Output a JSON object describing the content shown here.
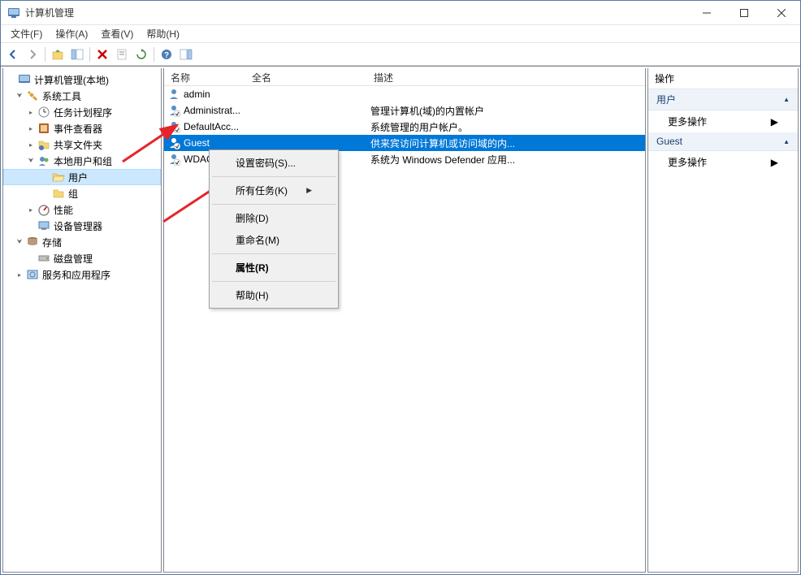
{
  "window": {
    "title": "计算机管理"
  },
  "menubar": {
    "file": "文件(F)",
    "action": "操作(A)",
    "view": "查看(V)",
    "help": "帮助(H)"
  },
  "tree": {
    "root": "计算机管理(本地)",
    "system_tools": "系统工具",
    "task_scheduler": "任务计划程序",
    "event_viewer": "事件查看器",
    "shared_folders": "共享文件夹",
    "local_users_groups": "本地用户和组",
    "users": "用户",
    "groups": "组",
    "performance": "性能",
    "device_manager": "设备管理器",
    "storage": "存储",
    "disk_management": "磁盘管理",
    "services_apps": "服务和应用程序"
  },
  "list": {
    "columns": {
      "name": "名称",
      "fullname": "全名",
      "description": "描述"
    },
    "rows": [
      {
        "name": "admin",
        "fullname": "",
        "description": "",
        "disabled": false
      },
      {
        "name": "Administrat...",
        "fullname": "",
        "description": "管理计算机(域)的内置帐户",
        "disabled": true
      },
      {
        "name": "DefaultAcc...",
        "fullname": "",
        "description": "系统管理的用户帐户。",
        "disabled": true
      },
      {
        "name": "Guest",
        "fullname": "",
        "description": "供来宾访问计算机或访问域的内...",
        "disabled": true,
        "selected": true
      },
      {
        "name": "WDAG...",
        "fullname": "",
        "description": "系统为 Windows Defender 应用...",
        "disabled": true
      }
    ]
  },
  "actions": {
    "title": "操作",
    "section1": "用户",
    "more1": "更多操作",
    "section2": "Guest",
    "more2": "更多操作"
  },
  "context_menu": {
    "set_password": "设置密码(S)...",
    "all_tasks": "所有任务(K)",
    "delete": "删除(D)",
    "rename": "重命名(M)",
    "properties": "属性(R)",
    "help": "帮助(H)"
  }
}
